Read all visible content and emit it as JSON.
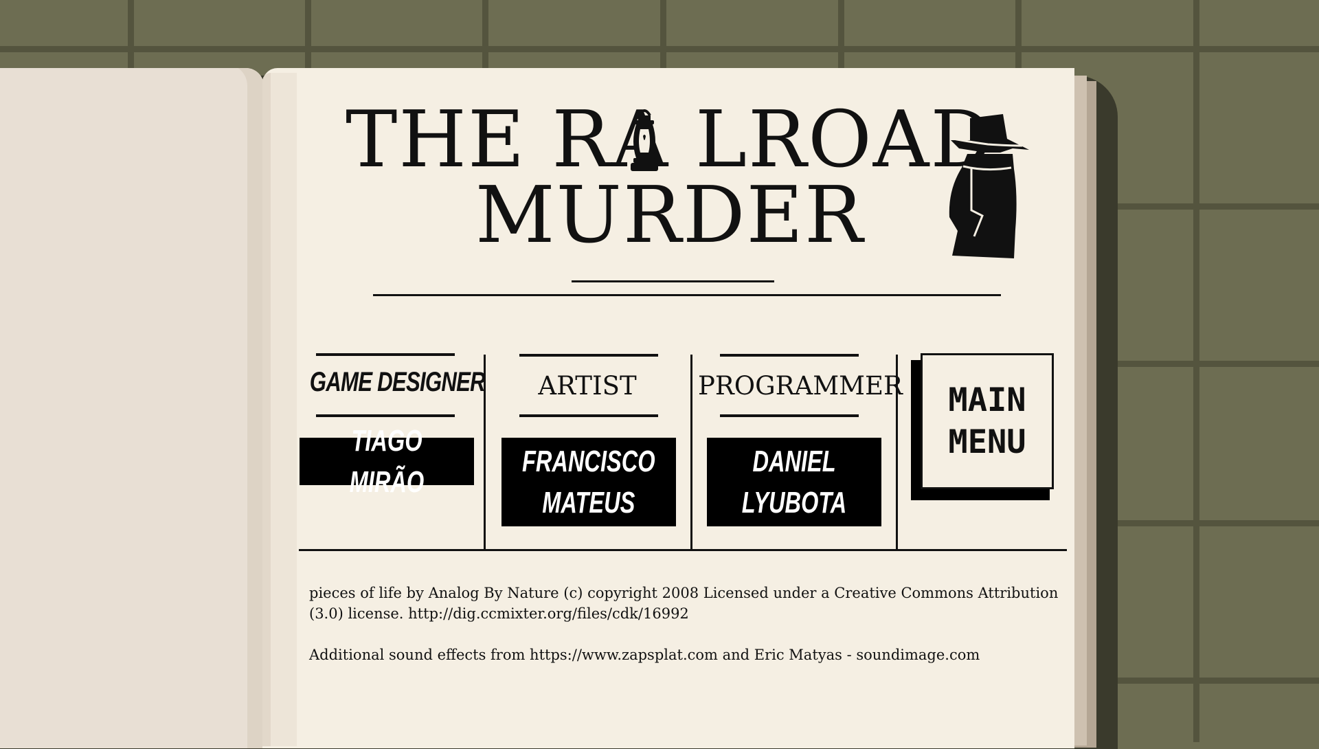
{
  "title": {
    "line1": "THE RA LROAD",
    "line2": "MURDER"
  },
  "credits": [
    {
      "role": "GAME DESIGNER",
      "name": "TIAGO MIRÃO"
    },
    {
      "role": "ARTIST",
      "name": "FRANCISCO\nMATEUS"
    },
    {
      "role": "PROGRAMMER",
      "name": "DANIEL\nLYUBOTA"
    }
  ],
  "main_menu_label": "MAIN\nMENU",
  "attribution": {
    "music": "pieces of life by Analog By Nature (c) copyright 2008 Licensed under a Creative Commons Attribution (3.0) license. http://dig.ccmixter.org/files/cdk/16992",
    "sfx": "Additional sound effects from https://www.zapsplat.com and Eric Matyas - soundimage.com"
  },
  "icons": [
    "lantern-icon",
    "detective-icon"
  ],
  "colors": {
    "table": "#6d6d52",
    "page": "#f5efe3",
    "ink": "#111111"
  }
}
